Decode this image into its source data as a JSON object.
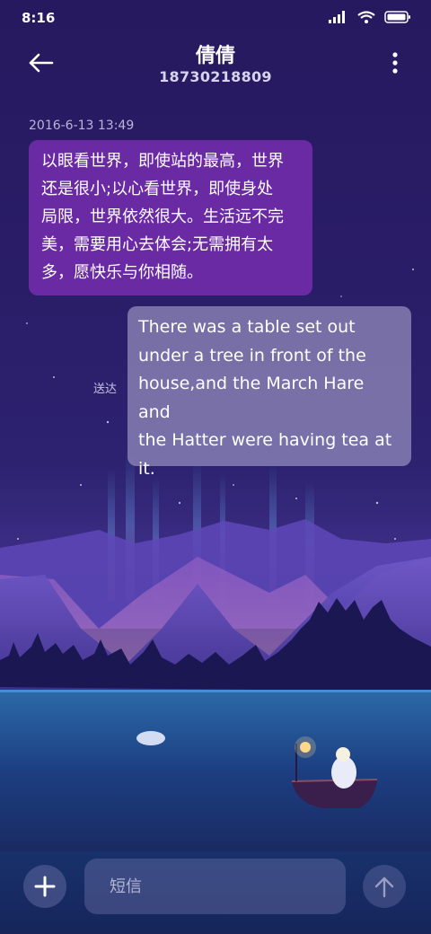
{
  "status_bar": {
    "time": "8:16",
    "icons": [
      "signal-icon",
      "wifi-icon",
      "battery-icon"
    ]
  },
  "header": {
    "contact_name": "倩倩",
    "contact_number": "18730218809",
    "back_icon": "arrow-left-icon",
    "more_icon": "more-vertical-icon"
  },
  "conversation": {
    "timestamp": "2016-6-13 13:49",
    "messages": [
      {
        "direction": "incoming",
        "lines": [
          "以眼看世界，即使站的最高，世界",
          "还是很小;以心看世界，即使身处",
          "局限，世界依然很大。生活远不完",
          "美，需要用心去体会;无需拥有太",
          "多，愿快乐与你相随。"
        ]
      },
      {
        "direction": "outgoing",
        "status": "送达",
        "lines": [
          "There was a table set out",
          "under a tree in front of the",
          "house,and the March Hare and",
          "the Hatter were having tea at",
          "it."
        ]
      }
    ]
  },
  "compose": {
    "placeholder": "短信",
    "value": "",
    "add_icon": "plus-icon",
    "send_icon": "arrow-up-icon"
  },
  "colors": {
    "incoming_bubble": "#6a2aa3",
    "outgoing_bubble": "#968fbe",
    "background_top": "#27195f"
  }
}
